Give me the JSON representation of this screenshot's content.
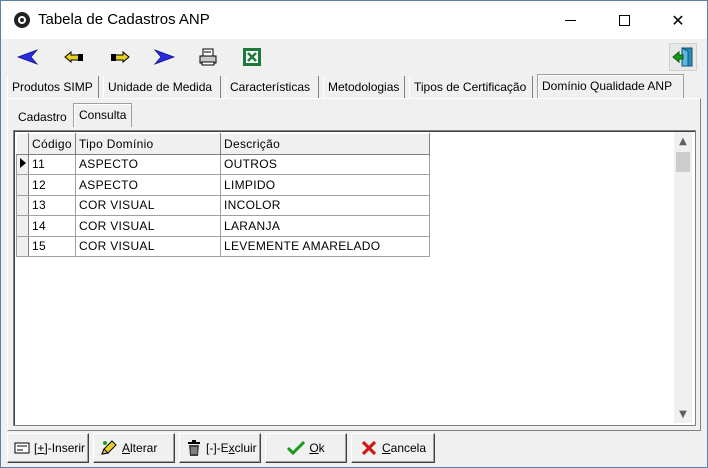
{
  "window": {
    "title": "Tabela de Cadastros ANP"
  },
  "toolbar": {
    "icons": [
      "first-record-icon",
      "prev-record-icon",
      "next-record-icon",
      "last-record-icon",
      "print-icon",
      "excel-icon",
      "exit-icon"
    ]
  },
  "tabs": [
    {
      "label": "Produtos SIMP"
    },
    {
      "label": "Unidade de Medida"
    },
    {
      "label": "Características"
    },
    {
      "label": "Metodologias"
    },
    {
      "label": "Tipos de Certificação"
    },
    {
      "label": "Domínio Qualidade ANP",
      "active": true
    }
  ],
  "subtabs": [
    {
      "label": "Cadastro"
    },
    {
      "label": "Consulta",
      "active": true
    }
  ],
  "grid": {
    "columns": [
      "Código",
      "Tipo Domínio",
      "Descrição"
    ],
    "rows": [
      {
        "codigo": "11",
        "tipo": "ASPECTO",
        "descricao": "OUTROS",
        "current": true
      },
      {
        "codigo": "12",
        "tipo": "ASPECTO",
        "descricao": "LIMPIDO"
      },
      {
        "codigo": "13",
        "tipo": "COR VISUAL",
        "descricao": "INCOLOR"
      },
      {
        "codigo": "14",
        "tipo": "COR VISUAL",
        "descricao": "LARANJA"
      },
      {
        "codigo": "15",
        "tipo": "COR VISUAL",
        "descricao": "LEVEMENTE AMARELADO"
      }
    ]
  },
  "buttons": {
    "inserir": {
      "prefix": "[",
      "underline": "+",
      "suffix": "]-Inserir"
    },
    "alterar": {
      "underline": "A",
      "suffix": "lterar"
    },
    "excluir": {
      "prefix": "[-]-E",
      "underline": "x",
      "suffix": "cluir"
    },
    "ok": {
      "underline": "O",
      "suffix": "k"
    },
    "cancela": {
      "underline": "C",
      "suffix": "ancela"
    }
  },
  "colors": {
    "nav_blue": "#2a2ae0",
    "nav_yellow": "#e8d020",
    "excel_green": "#1e7a3c",
    "ok_green": "#1a9a1a",
    "cancel_red": "#d01818"
  }
}
